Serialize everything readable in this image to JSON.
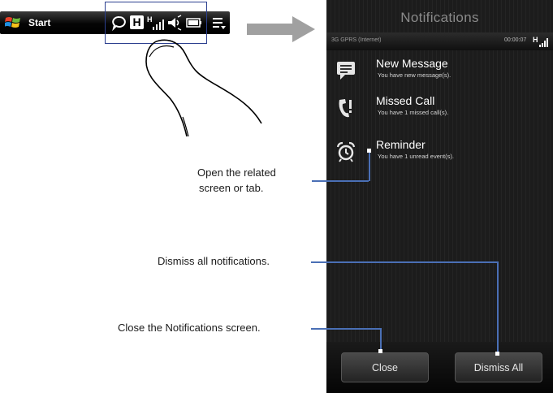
{
  "taskbar": {
    "start_label": "Start",
    "icons": [
      "notification-icon",
      "data-connection-icon",
      "signal-strength-icon",
      "volume-icon",
      "battery-icon",
      "menu-icon"
    ],
    "connection_letter": "H"
  },
  "phone": {
    "title": "Notifications",
    "status": {
      "connection": "3G GPRS (Internet)",
      "time": "00:00:07",
      "network_letter": "H"
    },
    "notifications": [
      {
        "title": "New Message",
        "subtitle": "You have new message(s).",
        "icon": "message-icon"
      },
      {
        "title": "Missed Call",
        "subtitle": "You have 1 missed call(s).",
        "icon": "missed-call-icon"
      },
      {
        "title": "Reminder",
        "subtitle": "You have 1 unread event(s).",
        "icon": "alarm-clock-icon"
      }
    ],
    "buttons": {
      "close": "Close",
      "dismiss_all": "Dismiss All"
    }
  },
  "callouts": {
    "open_line1": "Open the related",
    "open_line2": "screen or tab.",
    "dismiss": "Dismiss all notifications.",
    "close": "Close the Notifications screen."
  },
  "colors": {
    "callout_line": "#4a6fb5",
    "highlight_box": "#2b3f8f",
    "phone_background": "#1c1c1c"
  }
}
